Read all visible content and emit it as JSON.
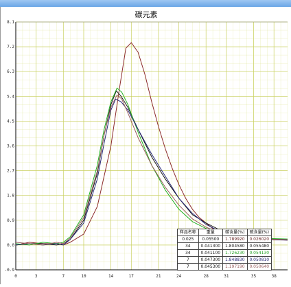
{
  "window": {
    "title": "碳元素"
  },
  "chart_data": {
    "type": "line",
    "title": "碳元素",
    "xlabel": "",
    "ylabel": "",
    "xlim": [
      0,
      40
    ],
    "ylim": [
      -0.9,
      8.1
    ],
    "x_ticks": [
      "0",
      "3",
      "7",
      "10",
      "14",
      "17",
      "21",
      "24",
      "28",
      "31",
      "35",
      "38"
    ],
    "y_ticks": [
      "8.1",
      "7.2",
      "6.3",
      "5.4",
      "4.5",
      "3.6",
      "2.7",
      "1.8",
      "0.9",
      "0.0",
      "-0.9"
    ],
    "grid": true,
    "colors": {
      "grid": "#d6dd7a",
      "axis": "#000000",
      "series": [
        "#8b2a2a",
        "#1a1a1a",
        "#22b022",
        "#2a2a7a",
        "#9a6060"
      ]
    },
    "series": [
      {
        "values": [
          [
            0,
            0
          ],
          [
            2,
            0.1
          ],
          [
            4,
            0.05
          ],
          [
            6,
            0.05
          ],
          [
            7,
            0.0
          ],
          [
            8,
            0.1
          ],
          [
            10,
            0.4
          ],
          [
            12,
            1.4
          ],
          [
            14,
            3.6
          ],
          [
            15.2,
            5.6
          ],
          [
            16.2,
            7.15
          ],
          [
            17,
            7.35
          ],
          [
            18,
            7.0
          ],
          [
            19,
            6.2
          ],
          [
            20,
            5.2
          ],
          [
            21,
            4.3
          ],
          [
            22,
            3.5
          ],
          [
            23,
            2.8
          ],
          [
            24,
            2.2
          ],
          [
            25,
            1.7
          ],
          [
            26,
            1.3
          ],
          [
            27,
            1.0
          ],
          [
            28,
            0.8
          ],
          [
            29,
            0.6
          ],
          [
            30,
            0.45
          ],
          [
            32,
            0.3
          ],
          [
            36,
            0.2
          ],
          [
            40,
            0.18
          ]
        ]
      },
      {
        "values": [
          [
            0,
            0
          ],
          [
            2,
            0.05
          ],
          [
            4,
            0.05
          ],
          [
            6,
            0.0
          ],
          [
            7,
            0.05
          ],
          [
            8,
            0.2
          ],
          [
            10,
            0.9
          ],
          [
            12,
            2.6
          ],
          [
            13,
            4.0
          ],
          [
            14,
            5.1
          ],
          [
            14.8,
            5.6
          ],
          [
            15.5,
            5.4
          ],
          [
            16.5,
            5.0
          ],
          [
            18,
            4.2
          ],
          [
            20,
            3.2
          ],
          [
            22,
            2.4
          ],
          [
            24,
            1.7
          ],
          [
            26,
            1.1
          ],
          [
            28,
            0.8
          ],
          [
            30,
            0.55
          ],
          [
            32,
            0.4
          ],
          [
            36,
            0.25
          ],
          [
            40,
            0.2
          ]
        ]
      },
      {
        "values": [
          [
            0,
            0.05
          ],
          [
            2,
            0.0
          ],
          [
            4,
            0.1
          ],
          [
            6,
            0.05
          ],
          [
            7,
            0.1
          ],
          [
            8,
            0.3
          ],
          [
            10,
            1.1
          ],
          [
            12,
            2.9
          ],
          [
            13,
            4.2
          ],
          [
            14,
            5.2
          ],
          [
            14.9,
            5.7
          ],
          [
            15.6,
            5.55
          ],
          [
            16.5,
            5.1
          ],
          [
            18,
            4.1
          ],
          [
            20,
            2.9
          ],
          [
            22,
            2.0
          ],
          [
            24,
            1.3
          ],
          [
            26,
            0.85
          ],
          [
            28,
            0.6
          ],
          [
            30,
            0.45
          ],
          [
            32,
            0.35
          ],
          [
            36,
            0.25
          ],
          [
            40,
            0.22
          ]
        ]
      },
      {
        "values": [
          [
            0,
            0
          ],
          [
            2,
            0.05
          ],
          [
            4,
            0.0
          ],
          [
            6,
            0.05
          ],
          [
            7,
            0.0
          ],
          [
            8,
            0.2
          ],
          [
            10,
            0.8
          ],
          [
            12,
            2.4
          ],
          [
            13,
            3.7
          ],
          [
            14,
            4.9
          ],
          [
            14.7,
            5.3
          ],
          [
            15.5,
            5.2
          ],
          [
            16.5,
            4.9
          ],
          [
            18,
            4.2
          ],
          [
            20,
            3.3
          ],
          [
            22,
            2.5
          ],
          [
            24,
            1.7
          ],
          [
            26,
            1.15
          ],
          [
            28,
            0.75
          ],
          [
            30,
            0.5
          ],
          [
            32,
            0.35
          ],
          [
            36,
            0.22
          ],
          [
            40,
            0.18
          ]
        ]
      },
      {
        "values": [
          [
            0,
            0.1
          ],
          [
            2,
            0.05
          ],
          [
            4,
            0.0
          ],
          [
            6,
            0.1
          ],
          [
            7,
            0.05
          ],
          [
            8,
            0.25
          ],
          [
            10,
            1.0
          ],
          [
            12,
            2.7
          ],
          [
            13,
            4.0
          ],
          [
            14,
            5.0
          ],
          [
            14.9,
            5.45
          ],
          [
            15.6,
            5.3
          ],
          [
            16.5,
            4.8
          ],
          [
            18,
            3.9
          ],
          [
            20,
            2.9
          ],
          [
            22,
            2.1
          ],
          [
            24,
            1.45
          ],
          [
            26,
            0.95
          ],
          [
            28,
            0.65
          ],
          [
            30,
            0.45
          ],
          [
            32,
            0.32
          ],
          [
            36,
            0.22
          ],
          [
            40,
            0.2
          ]
        ]
      }
    ]
  },
  "results_table": {
    "headers": [
      "样品名称",
      "重量",
      "碳含量(%)",
      "硫含量(%)"
    ],
    "rows": [
      [
        "0.025",
        "0.05500",
        "1.789920",
        "0.026020"
      ],
      [
        "34",
        "0.041300",
        "1.804580",
        "0.055480"
      ],
      [
        "34",
        "0.041100",
        "1.726230",
        "0.054130"
      ],
      [
        "7",
        "0.047300",
        "1.848830",
        "0.050810"
      ],
      [
        "7",
        "0.045300",
        "1.197190",
        "0.050640"
      ]
    ],
    "row_colors": [
      "#6b2a2a",
      "#1a1a1a",
      "#22a022",
      "#2a2a7a",
      "#9a6060"
    ]
  }
}
